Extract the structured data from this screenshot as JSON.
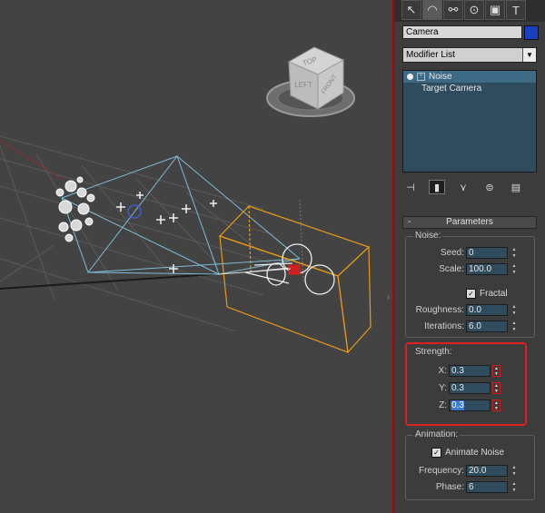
{
  "viewport": {
    "viewcube": {
      "top": "TOP",
      "left": "LEFT",
      "front": "FRONT"
    },
    "colors": {
      "frustum": "#7fbcd6",
      "selection": "#e89a16",
      "grid": "#5a5a5a"
    }
  },
  "command_panel": {
    "tabs": [
      {
        "icon": "create-icon",
        "glyph": "↖"
      },
      {
        "icon": "modify-icon",
        "glyph": "◠"
      },
      {
        "icon": "hierarchy-icon",
        "glyph": "⚯"
      },
      {
        "icon": "motion-icon",
        "glyph": "⊙"
      },
      {
        "icon": "display-icon",
        "glyph": "▣"
      },
      {
        "icon": "utilities-icon",
        "glyph": "T"
      }
    ],
    "object_name": "Camera",
    "object_color": "#1a3fc0",
    "modifier_list_label": "Modifier List",
    "stack": [
      {
        "label": "Noise",
        "selected": true
      },
      {
        "label": "Target Camera",
        "selected": false
      }
    ]
  },
  "parameters": {
    "title": "Parameters",
    "noise": {
      "group": "Noise:",
      "seed_label": "Seed:",
      "seed": "0",
      "scale_label": "Scale:",
      "scale": "100.0",
      "fractal_label": "Fractal",
      "fractal_checked": true,
      "roughness_label": "Roughness:",
      "roughness": "0.0",
      "iterations_label": "Iterations:",
      "iterations": "6.0"
    },
    "strength": {
      "group": "Strength:",
      "x_label": "X:",
      "x": "0.3",
      "y_label": "Y:",
      "y": "0.3",
      "z_label": "Z:",
      "z": "0.3"
    },
    "animation": {
      "group": "Animation:",
      "animate_label": "Animate Noise",
      "animate_checked": true,
      "frequency_label": "Frequency:",
      "frequency": "20.0",
      "phase_label": "Phase:",
      "phase": "6"
    }
  }
}
